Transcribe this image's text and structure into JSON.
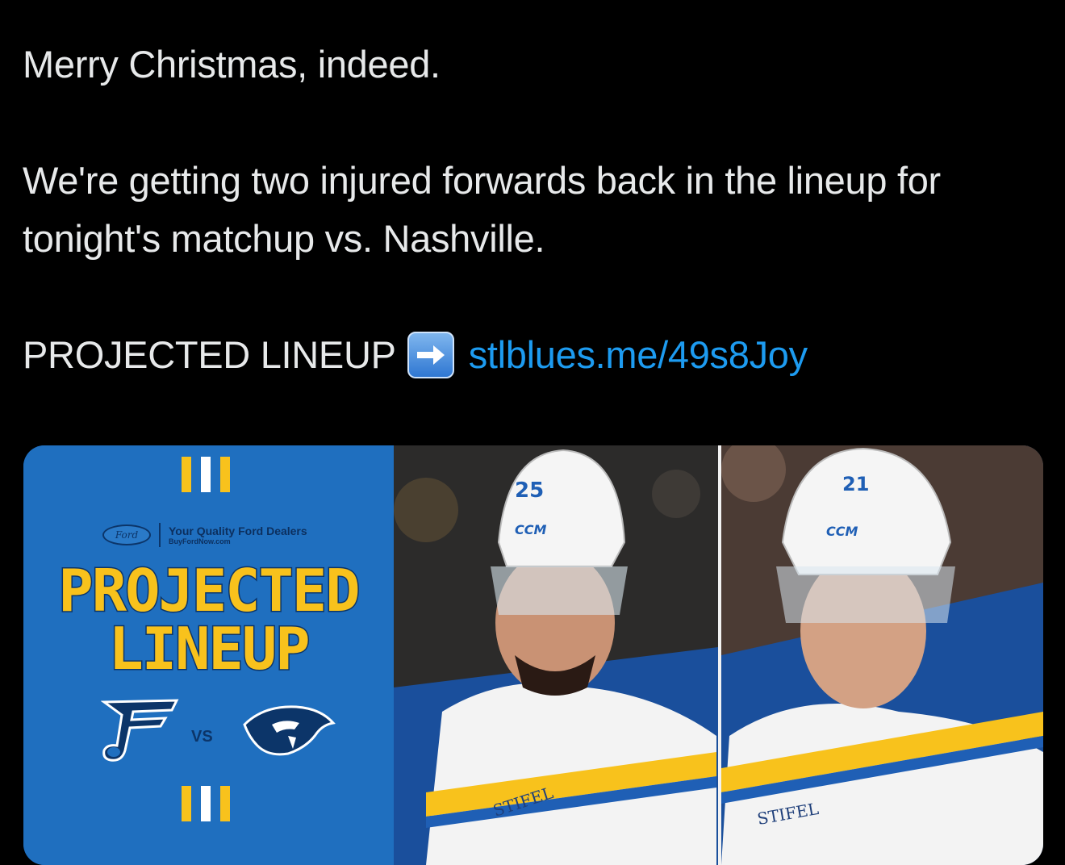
{
  "tweet": {
    "line1": "Merry Christmas, indeed.",
    "line2": "We're getting two injured forwards back in the lineup for tonight's matchup vs. Nashville.",
    "lineup_prefix": "PROJECTED LINEUP",
    "arrow_icon": "right-arrow-emoji",
    "link_text": "stlblues.me/49s8Joy",
    "link_color": "#1d9bf0"
  },
  "media": {
    "sponsor_logo_text": "Ford",
    "sponsor_main": "Your Quality Ford Dealers",
    "sponsor_sub": "BuyFordNow.com",
    "title_line1": "PROJECTED",
    "title_line2": "LINEUP",
    "vs_label": "VS",
    "home_team_icon": "st-louis-blues-logo",
    "away_team_icon": "nashville-predators-logo",
    "player_left": {
      "number": "25",
      "helmet_brand": "CCM",
      "jersey_sponsor": "STIFEL"
    },
    "player_right": {
      "number": "21",
      "helmet_brand": "CCM",
      "jersey_sponsor": "STIFEL"
    },
    "colors": {
      "blues_blue": "#1f6fbf",
      "blues_yellow": "#f8c21c",
      "navy": "#0c3569"
    }
  }
}
